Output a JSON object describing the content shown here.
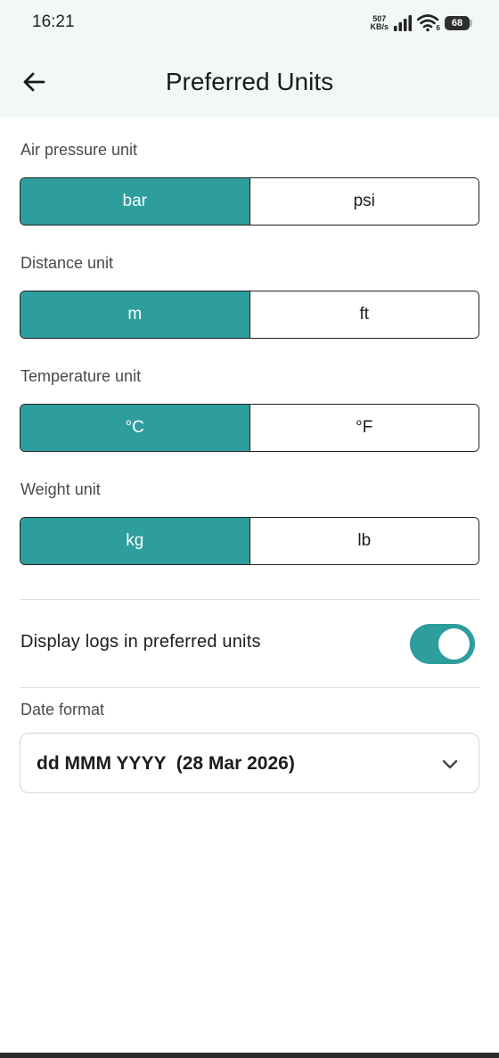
{
  "status_bar": {
    "time": "16:21",
    "net_speed_value": "507",
    "net_speed_unit": "KB/s",
    "wifi_badge": "6",
    "battery": "68"
  },
  "app_bar": {
    "title": "Preferred Units"
  },
  "settings": {
    "air_pressure": {
      "label": "Air pressure unit",
      "options": [
        "bar",
        "psi"
      ],
      "selected": "bar"
    },
    "distance": {
      "label": "Distance unit",
      "options": [
        "m",
        "ft"
      ],
      "selected": "m"
    },
    "temperature": {
      "label": "Temperature unit",
      "options": [
        "°C",
        "°F"
      ],
      "selected": "°C"
    },
    "weight": {
      "label": "Weight unit",
      "options": [
        "kg",
        "lb"
      ],
      "selected": "kg"
    }
  },
  "logs_toggle": {
    "label": "Display logs in preferred units",
    "enabled": true
  },
  "date_format": {
    "label": "Date format",
    "value": "dd MMM YYYY  (28 Mar 2026)"
  },
  "colors": {
    "accent": "#2e9d9d",
    "header_bg": "#f2f7f7"
  }
}
